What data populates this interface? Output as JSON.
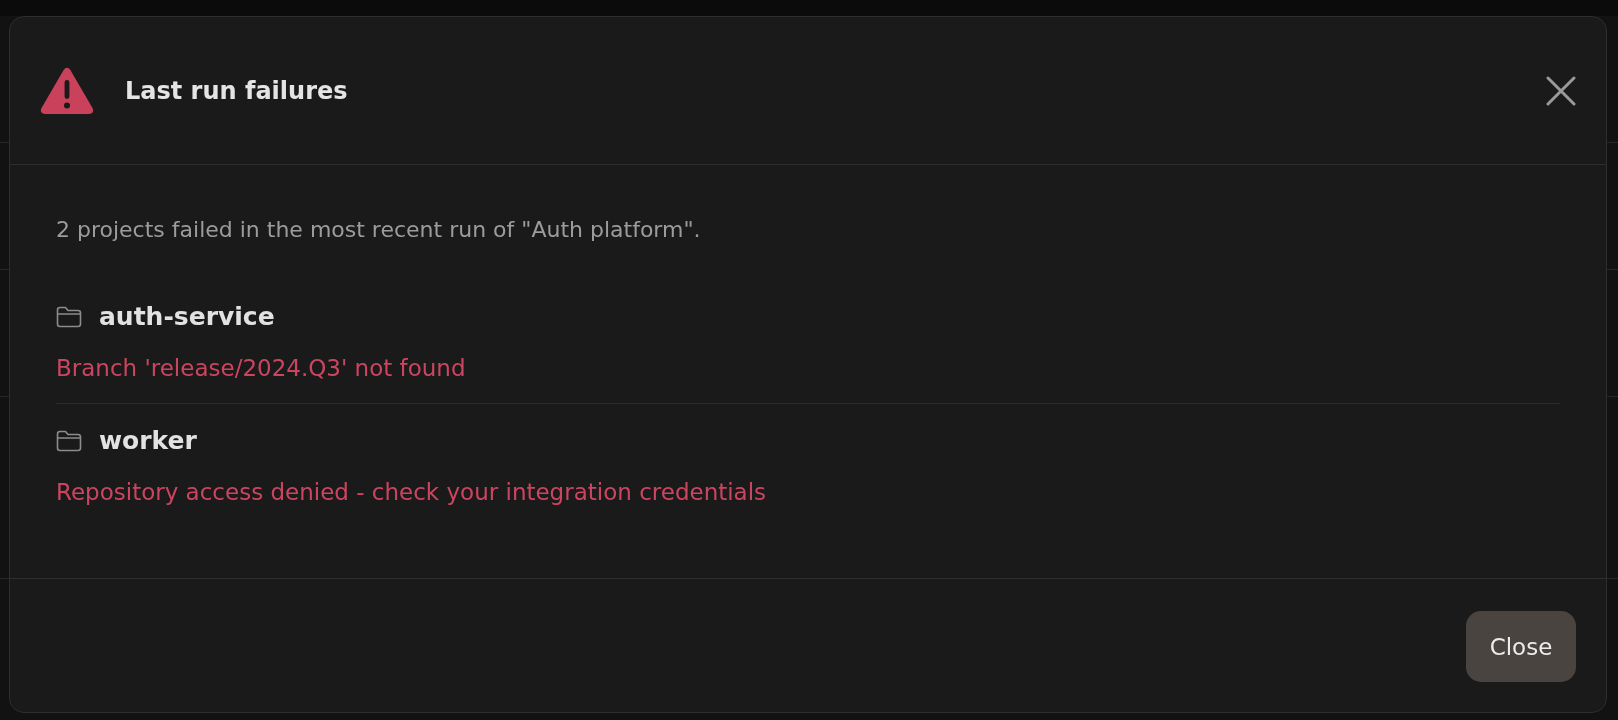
{
  "dialog": {
    "title": "Last run failures",
    "message": "2 projects failed in the most recent run of \"Auth platform\".",
    "projects": [
      {
        "name": "auth-service",
        "error": "Branch 'release/2024.Q3' not found"
      },
      {
        "name": "worker",
        "error": "Repository access denied - check your integration credentials"
      }
    ],
    "buttons": [
      "Close"
    ]
  }
}
